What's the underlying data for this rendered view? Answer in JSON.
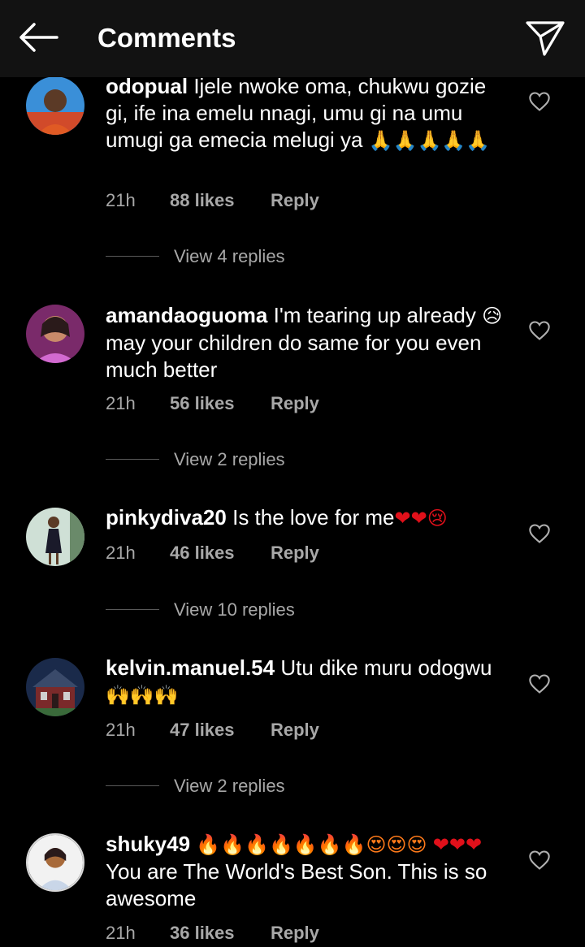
{
  "header": {
    "title": "Comments"
  },
  "comments": [
    {
      "username": "odopual",
      "text": "Ijele nwoke oma, chukwu gozie gi, ife ina emelu nnagi, umu gi na umu umugi ga emecia melugi ya",
      "emoji": "🙏🙏🙏🙏🙏",
      "time": "21h",
      "likes": "88 likes",
      "reply": "Reply",
      "view_replies": "View 4 replies"
    },
    {
      "username": "amandaoguoma",
      "text_before": "I'm tearing up already",
      "emoji": "😥",
      "text": "may your children do same for you even much better",
      "time": "21h",
      "likes": "56 likes",
      "reply": "Reply",
      "view_replies": "View 2 replies"
    },
    {
      "username": "pinkydiva20",
      "text": "Is the love for me",
      "emoji": "❤❤😢",
      "time": "21h",
      "likes": "46 likes",
      "reply": "Reply",
      "view_replies": "View 10 replies"
    },
    {
      "username": "kelvin.manuel.54",
      "text": "Utu dike muru odogwu",
      "emoji": "🙌🙌🙌",
      "time": "21h",
      "likes": "47 likes",
      "reply": "Reply",
      "view_replies": "View 2 replies"
    },
    {
      "username": "shuky49",
      "emoji": "🔥🔥🔥🔥🔥🔥🔥😍😍😍",
      "emoji_2": "❤❤❤",
      "text": "You are The World's Best Son. This is so awesome",
      "time": "21h",
      "likes": "36 likes",
      "reply": "Reply"
    }
  ],
  "colors": {
    "background": "#000000",
    "header_background": "#121212",
    "text_primary": "#ffffff",
    "text_secondary": "#a8a8a8"
  },
  "icons": {
    "back": "arrow-left-icon",
    "send": "paper-plane-icon",
    "like": "heart-outline-icon"
  }
}
